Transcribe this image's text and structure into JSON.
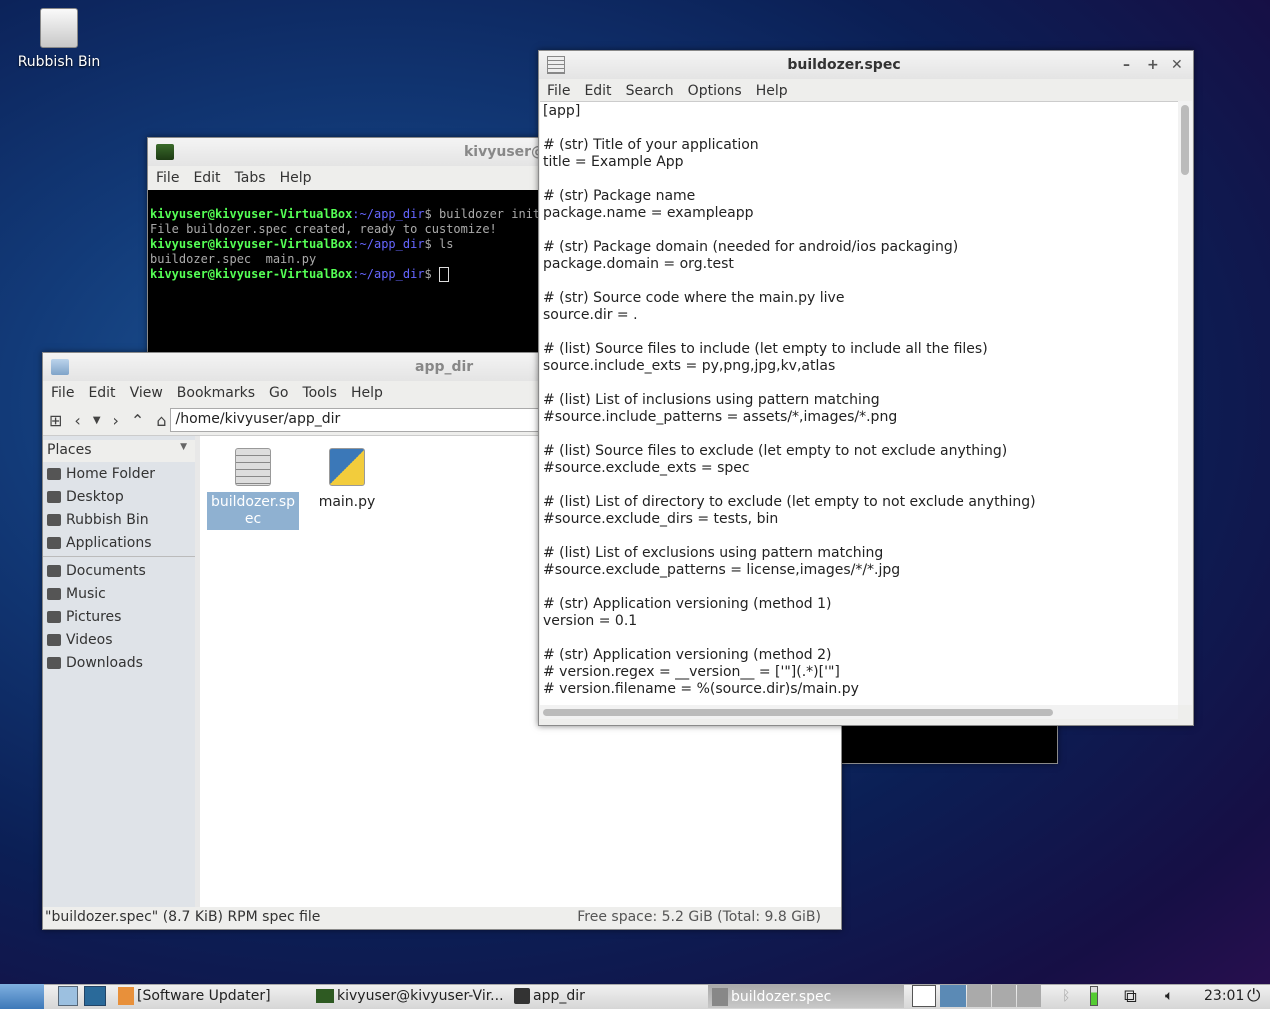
{
  "desktop": {
    "icons": [
      {
        "label": "Rubbish Bin",
        "icon": "trash-icon"
      }
    ]
  },
  "terminal": {
    "title": "kivyuser@kivyuser-VirtualBox: ~/app_dir",
    "menu": [
      "File",
      "Edit",
      "Tabs",
      "Help"
    ],
    "lines": [
      {
        "prompt": "kivyuser@kivyuser-VirtualBox",
        "path": ":~/app_dir",
        "cmd": "$ buildozer init"
      },
      {
        "out": "File buildozer.spec created, ready to customize!"
      },
      {
        "prompt": "kivyuser@kivyuser-VirtualBox",
        "path": ":~/app_dir",
        "cmd": "$ ls"
      },
      {
        "out": "buildozer.spec  main.py"
      },
      {
        "prompt": "kivyuser@kivyuser-VirtualBox",
        "path": ":~/app_dir",
        "cmd": "$ "
      }
    ]
  },
  "filemanager": {
    "title": "app_dir",
    "menu": [
      "File",
      "Edit",
      "View",
      "Bookmarks",
      "Go",
      "Tools",
      "Help"
    ],
    "path": "/home/kivyuser/app_dir",
    "places_label": "Places",
    "places": [
      {
        "label": "Home Folder",
        "icon": "home-icon"
      },
      {
        "label": "Desktop",
        "icon": "desktop-icon"
      },
      {
        "label": "Rubbish Bin",
        "icon": "trash-icon"
      },
      {
        "label": "Applications",
        "icon": "applications-icon"
      }
    ],
    "bookmarks": [
      {
        "label": "Documents"
      },
      {
        "label": "Music"
      },
      {
        "label": "Pictures"
      },
      {
        "label": "Videos"
      },
      {
        "label": "Downloads"
      }
    ],
    "files": [
      {
        "name": "buildozer.spec",
        "display": "buildozer.sp ec",
        "selected": true,
        "icon": "text-file-icon"
      },
      {
        "name": "main.py",
        "display": "main.py",
        "selected": false,
        "icon": "python-file-icon"
      }
    ],
    "status_left": "\"buildozer.spec\" (8.7 KiB) RPM spec file",
    "status_right": "Free space: 5.2 GiB (Total: 9.8 GiB)"
  },
  "editor": {
    "title": "buildozer.spec",
    "menu": [
      "File",
      "Edit",
      "Search",
      "Options",
      "Help"
    ],
    "lines": [
      "[app]",
      "",
      "# (str) Title of your application",
      "title = Example App",
      "",
      "# (str) Package name",
      "package.name = exampleapp",
      "",
      "# (str) Package domain (needed for android/ios packaging)",
      "package.domain = org.test",
      "",
      "# (str) Source code where the main.py live",
      "source.dir = .",
      "",
      "# (list) Source files to include (let empty to include all the files)",
      "source.include_exts = py,png,jpg,kv,atlas",
      "",
      "# (list) List of inclusions using pattern matching",
      "#source.include_patterns = assets/*,images/*.png",
      "",
      "# (list) Source files to exclude (let empty to not exclude anything)",
      "#source.exclude_exts = spec",
      "",
      "# (list) List of directory to exclude (let empty to not exclude anything)",
      "#source.exclude_dirs = tests, bin",
      "",
      "# (list) List of exclusions using pattern matching",
      "#source.exclude_patterns = license,images/*/*.jpg",
      "",
      "# (str) Application versioning (method 1)",
      "version = 0.1",
      "",
      "# (str) Application versioning (method 2)",
      "# version.regex = __version__ = ['\"](.*)['\"]",
      "# version.filename = %(source.dir)s/main.py"
    ]
  },
  "taskbar": {
    "tasks": [
      {
        "label": "[Software Updater]",
        "icon": "software-updater-icon"
      },
      {
        "label": "kivyuser@kivyuser-Vir...",
        "icon": "terminal-icon"
      },
      {
        "label": "app_dir",
        "icon": "folder-icon"
      },
      {
        "label": "buildozer.spec",
        "icon": "text-editor-icon",
        "active": true
      }
    ],
    "clock": "23:01"
  }
}
